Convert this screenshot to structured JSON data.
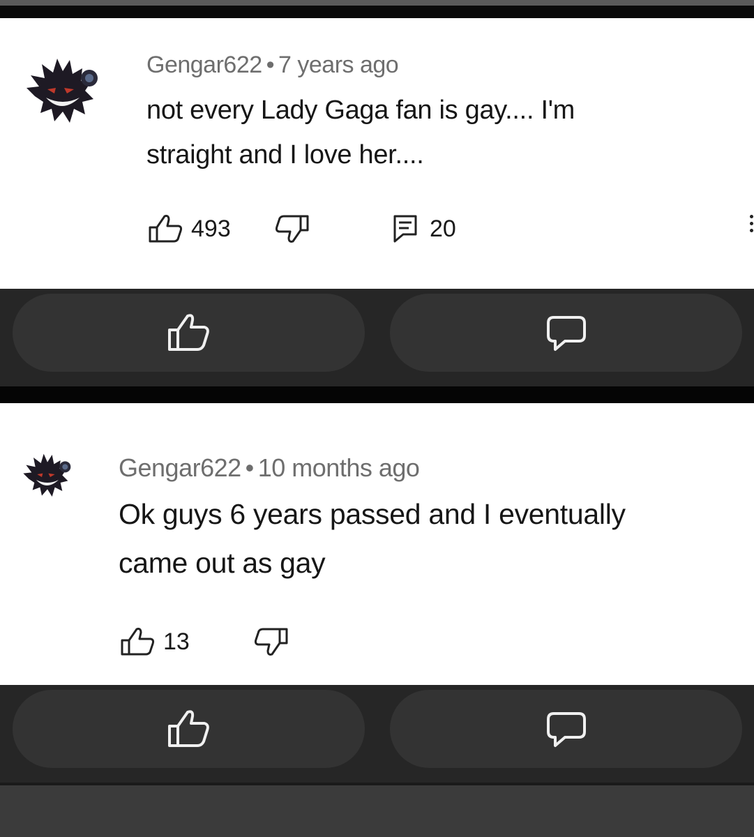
{
  "comments": [
    {
      "username": "Gengar622",
      "separator": "•",
      "timestamp": "7 years ago",
      "text_lines": [
        "not every Lady Gaga fan is gay.... I'm",
        "straight and I love her...."
      ],
      "likes": "493",
      "replies": "20"
    },
    {
      "username": "Gengar622",
      "separator": "•",
      "timestamp": "10 months ago",
      "text_lines": [
        "Ok guys 6 years passed and I eventually",
        "came out as gay"
      ],
      "likes": "13"
    }
  ],
  "icons": {
    "like": "thumbs-up-icon",
    "dislike": "thumbs-down-icon",
    "reply": "reply-icon",
    "comment": "comment-bubble-icon",
    "more": "kebab-menu-icon"
  },
  "colors": {
    "card_bg": "#ffffff",
    "bar_bg": "#262626",
    "pill_bg": "#333333",
    "meta_text": "#6e6e6e",
    "body_text": "#161616"
  }
}
